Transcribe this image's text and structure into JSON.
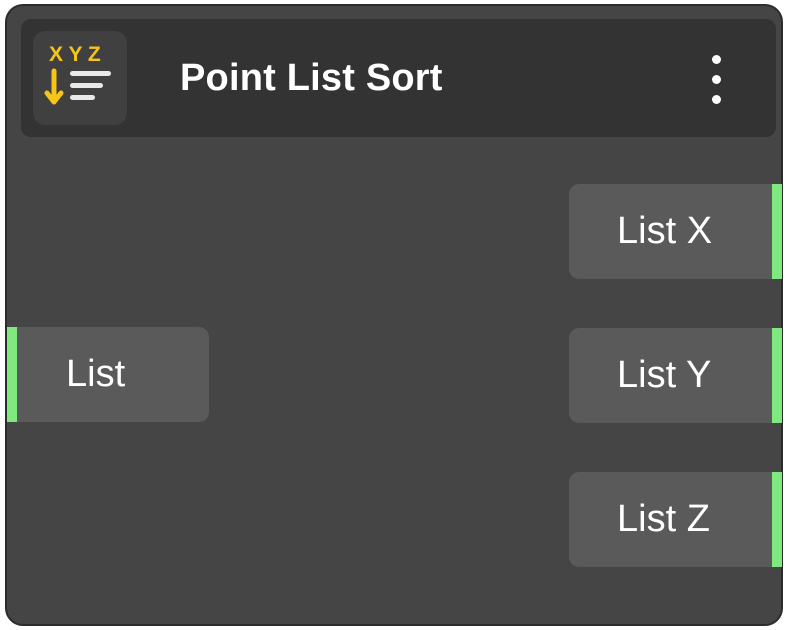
{
  "node": {
    "title": "Point List Sort",
    "icon": {
      "name": "xyz-sort-icon",
      "letters": "X Y Z",
      "color": "#f5c518"
    },
    "menu_icon": "more-vertical-icon"
  },
  "inputs": [
    {
      "label": "List"
    }
  ],
  "outputs": [
    {
      "label": "List X"
    },
    {
      "label": "List Y"
    },
    {
      "label": "List Z"
    }
  ],
  "colors": {
    "node_background": "#454545",
    "header_background": "#333333",
    "port_background": "#5a5a5a",
    "port_handle": "#7fe87f",
    "accent_icon": "#f5c518"
  }
}
